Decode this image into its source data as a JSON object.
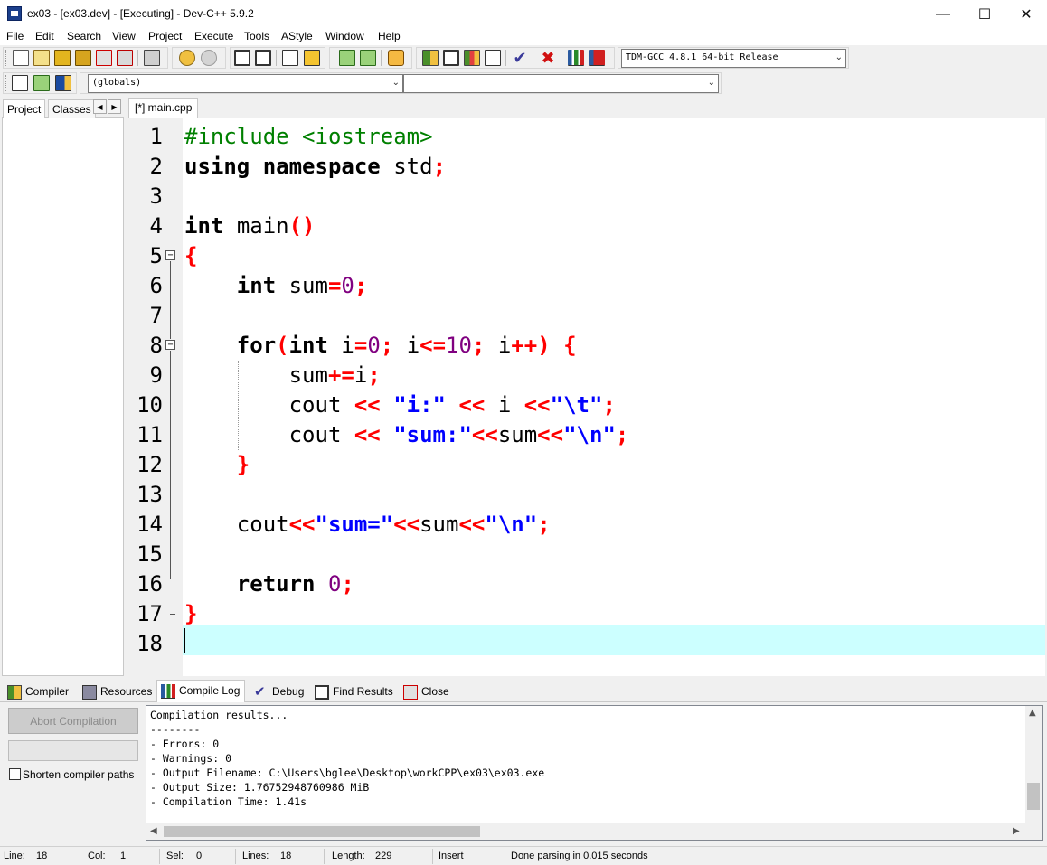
{
  "window": {
    "title": "ex03 - [ex03.dev] - [Executing] - Dev-C++ 5.9.2",
    "minimize": "—",
    "maximize": "☐",
    "close": "✕"
  },
  "menu": [
    "File",
    "Edit",
    "Search",
    "View",
    "Project",
    "Execute",
    "Tools",
    "AStyle",
    "Window",
    "Help"
  ],
  "toolbar": {
    "compiler_select": "TDM-GCC 4.8.1 64-bit Release",
    "scope_select": "(globals)",
    "member_select": ""
  },
  "left_panel": {
    "tabs": [
      "Project",
      "Classes"
    ],
    "arrow_left": "◀",
    "arrow_right": "▶"
  },
  "editor": {
    "tab_label": "[*] main.cpp",
    "line_numbers": [
      "1",
      "2",
      "3",
      "4",
      "5",
      "6",
      "7",
      "8",
      "9",
      "10",
      "11",
      "12",
      "13",
      "14",
      "15",
      "16",
      "17",
      "18"
    ],
    "fold_marker": "−",
    "tokens": {
      "l1_pp": "#include <iostream>",
      "l2_kw1": "using",
      "l2_kw2": "namespace",
      "l2_id": "std",
      "semi": ";",
      "l4_kw": "int",
      "l4_id": "main",
      "parens": "()",
      "lbrace": "{",
      "rbrace": "}",
      "l6_id": "sum",
      "eq": "=",
      "zero": "0",
      "l8_kw": "for",
      "lparen": "(",
      "rparen": ")",
      "i": "i",
      "le": "<=",
      "ten": "10",
      "pp": "++",
      "l9_op": "+=",
      "cout": "cout",
      "shl": "<<",
      "str_i": "\"i:\"",
      "str_t_open": "\"",
      "esc_t": "\\t",
      "str_close": "\"",
      "str_sum": "\"sum:\"",
      "esc_n": "\\n",
      "str_sumeq": "\"sum=\"",
      "ret": "return"
    }
  },
  "bottom_tabs": [
    "Compiler",
    "Resources",
    "Compile Log",
    "Debug",
    "Find Results",
    "Close"
  ],
  "compile_panel": {
    "abort_button": "Abort Compilation",
    "shorten_label": "Shorten compiler paths",
    "log_lines": [
      "Compilation results...",
      "--------",
      "- Errors: 0",
      "- Warnings: 0",
      "- Output Filename: C:\\Users\\bglee\\Desktop\\workCPP\\ex03\\ex03.exe",
      "- Output Size: 1.76752948760986 MiB",
      "- Compilation Time: 1.41s"
    ]
  },
  "statusbar": {
    "line_label": "Line:",
    "line_value": "18",
    "col_label": "Col:",
    "col_value": "1",
    "sel_label": "Sel:",
    "sel_value": "0",
    "lines_label": "Lines:",
    "lines_value": "18",
    "length_label": "Length:",
    "length_value": "229",
    "mode": "Insert",
    "message": "Done parsing in 0.015 seconds"
  }
}
